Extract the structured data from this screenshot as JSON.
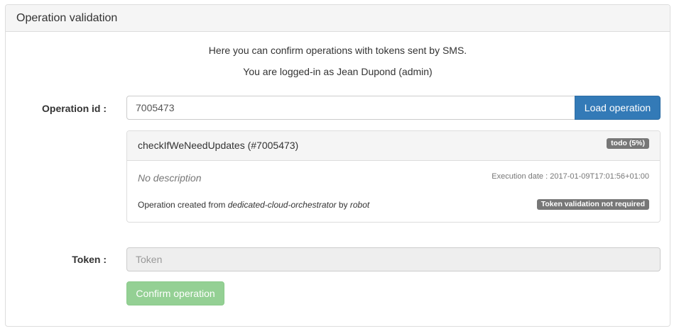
{
  "panel": {
    "title": "Operation validation"
  },
  "intro": {
    "line1": "Here you can confirm operations with tokens sent by SMS.",
    "line2": "You are logged-in as Jean Dupond (admin)"
  },
  "operation_field": {
    "label": "Operation id :",
    "value": "7005473",
    "button_label": "Load operation"
  },
  "operation": {
    "title": "checkIfWeNeedUpdates (#7005473)",
    "status_badge": "todo (5%)",
    "description": "No description",
    "execution_date_label": "Execution date :",
    "execution_date": "2017-01-09T17:01:56+01:00",
    "created_prefix": "Operation created from",
    "created_source": "dedicated-cloud-orchestrator",
    "created_by_word": "by",
    "created_by": "robot",
    "token_badge": "Token validation not required"
  },
  "token_field": {
    "label": "Token :",
    "placeholder": "Token",
    "value": ""
  },
  "confirm_button": {
    "label": "Confirm operation"
  },
  "colors": {
    "primary": "#337ab7",
    "success": "#5cb85c",
    "badge": "#777777"
  }
}
